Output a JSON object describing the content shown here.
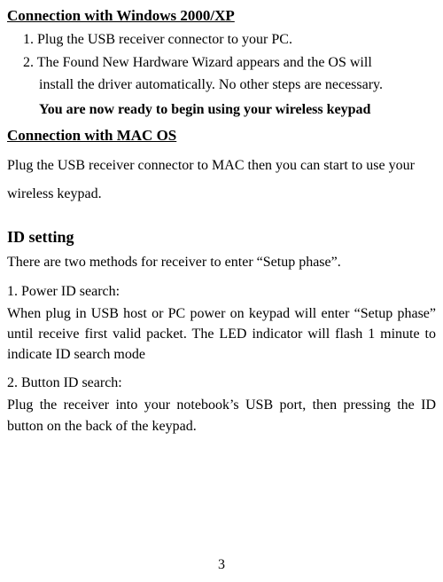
{
  "section1": {
    "heading": "Connection with Windows 2000/XP",
    "item1": "1. Plug the USB receiver connector to your PC.",
    "item2a": "2. The Found New Hardware Wizard appears and the OS will",
    "item2b": "install the driver automatically. No other steps are necessary.",
    "ready": "You are now ready to begin using your wireless keypad"
  },
  "section2": {
    "heading": "Connection with MAC OS",
    "paragraph": "Plug the USB receiver connector to MAC then you can start to use your wireless keypad."
  },
  "section3": {
    "heading": "ID setting",
    "intro": "There are two methods for receiver to enter “Setup phase”.",
    "sub1_title": "1. Power ID search:",
    "sub1_body": "When plug in USB host or PC power on keypad will enter “Setup phase” until receive first valid packet. The LED indicator will flash 1 minute to indicate ID search mode",
    "sub2_title": "2. Button ID search:",
    "sub2_body": "Plug the receiver into your notebook’s USB port, then pressing the ID button on the back of the keypad."
  },
  "page_number": "3"
}
